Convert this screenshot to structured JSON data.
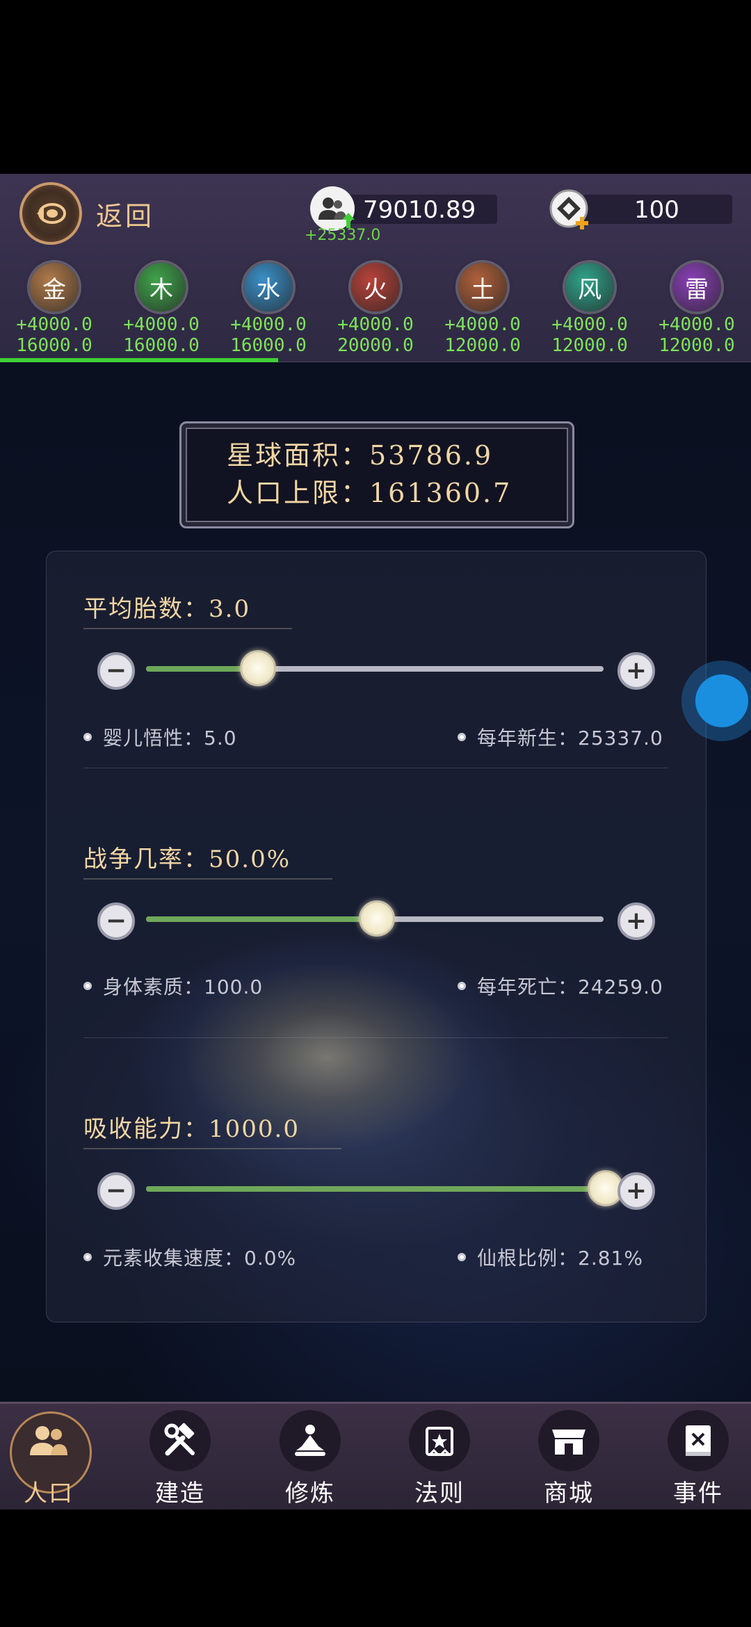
{
  "header": {
    "back_label": "返回",
    "population": {
      "value": "79010.89",
      "delta": "+25337.0"
    },
    "coin": {
      "value": "100"
    }
  },
  "elements": [
    {
      "name": "金",
      "rate": "+4000.0",
      "cap": "16000.0",
      "color": "#b07a4a"
    },
    {
      "name": "木",
      "rate": "+4000.0",
      "cap": "16000.0",
      "color": "#3fa34a"
    },
    {
      "name": "水",
      "rate": "+4000.0",
      "cap": "16000.0",
      "color": "#3a8fc8"
    },
    {
      "name": "火",
      "rate": "+4000.0",
      "cap": "20000.0",
      "color": "#b8423a"
    },
    {
      "name": "土",
      "rate": "+4000.0",
      "cap": "12000.0",
      "color": "#b0603a"
    },
    {
      "name": "风",
      "rate": "+4000.0",
      "cap": "12000.0",
      "color": "#2fa38a"
    },
    {
      "name": "雷",
      "rate": "+4000.0",
      "cap": "12000.0",
      "color": "#8a3fb8"
    }
  ],
  "planet": {
    "area_label": "星球面积：53786.9",
    "pop_cap_label": "人口上限：161360.7"
  },
  "sliders": [
    {
      "title": "平均胎数：3.0",
      "level": 0.24,
      "left_stat": "婴儿悟性：5.0",
      "right_stat": "每年新生：25337.0"
    },
    {
      "title": "战争几率：50.0%",
      "level": 0.5,
      "left_stat": "身体素质：100.0",
      "right_stat": "每年死亡：24259.0"
    },
    {
      "title": "吸收能力：1000.0",
      "level": 1.0,
      "left_stat": "元素收集速度：0.0%",
      "right_stat": "仙根比例：2.81%"
    }
  ],
  "nav": [
    {
      "label": "人口",
      "icon": "people-icon"
    },
    {
      "label": "建造",
      "icon": "hammer-wrench-icon"
    },
    {
      "label": "修炼",
      "icon": "meditation-icon"
    },
    {
      "label": "法则",
      "icon": "law-scroll-icon"
    },
    {
      "label": "商城",
      "icon": "shop-icon"
    },
    {
      "label": "事件",
      "icon": "event-book-icon"
    }
  ]
}
